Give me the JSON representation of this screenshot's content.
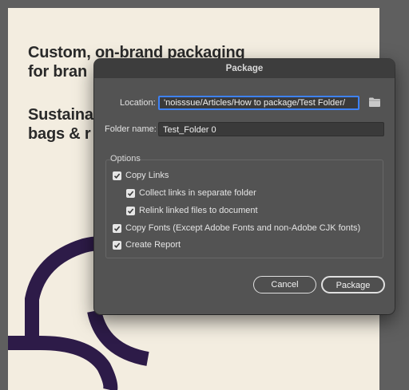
{
  "artboard": {
    "headline_line1": "Custom, on-brand packaging",
    "headline_line2": "for bran",
    "subhead_line1": "Sustaina",
    "subhead_line2": "bags & r",
    "brand_color": "#2d1b48"
  },
  "dialog": {
    "title": "Package",
    "location_label": "Location:",
    "location_value": "'noisssue/Articles/How to package/Test Folder/",
    "browse_icon": "folder-icon",
    "folder_name_label": "Folder name:",
    "folder_name_value": "Test_Folder 0",
    "options_label": "Options",
    "options": {
      "copy_links": {
        "label": "Copy Links",
        "checked": true
      },
      "collect_links": {
        "label": "Collect links in separate folder",
        "checked": true
      },
      "relink_files": {
        "label": "Relink linked files to document",
        "checked": true
      },
      "copy_fonts": {
        "label": "Copy Fonts (Except Adobe Fonts and non-Adobe CJK fonts)",
        "checked": true
      },
      "create_report": {
        "label": "Create Report",
        "checked": true
      }
    },
    "cancel_label": "Cancel",
    "package_label": "Package",
    "accent_color": "#3e82f7"
  }
}
